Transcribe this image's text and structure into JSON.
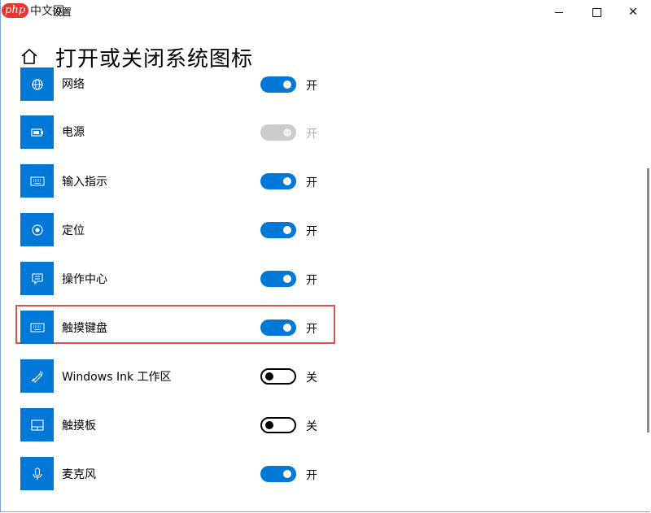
{
  "titlebar": {
    "logo_php": "php",
    "logo_cn": "中文网",
    "app_title": "设置",
    "minimize_icon": "minimize-icon",
    "maximize_icon": "maximize-icon",
    "close_icon": "close-icon",
    "close_glyph": "✕"
  },
  "header": {
    "home_icon": "home-icon",
    "title": "打开或关闭系统图标"
  },
  "items": [
    {
      "label": "网络",
      "state": "开",
      "on": true,
      "disabled": false,
      "icon": "globe-icon"
    },
    {
      "label": "电源",
      "state": "开",
      "on": true,
      "disabled": true,
      "icon": "battery-icon"
    },
    {
      "label": "输入指示",
      "state": "开",
      "on": true,
      "disabled": false,
      "icon": "keyboard-icon"
    },
    {
      "label": "定位",
      "state": "开",
      "on": true,
      "disabled": false,
      "icon": "location-icon"
    },
    {
      "label": "操作中心",
      "state": "开",
      "on": true,
      "disabled": false,
      "icon": "action-center-icon"
    },
    {
      "label": "触摸键盘",
      "state": "开",
      "on": true,
      "disabled": false,
      "icon": "touch-keyboard-icon"
    },
    {
      "label": "Windows Ink 工作区",
      "state": "关",
      "on": false,
      "disabled": false,
      "icon": "pen-icon"
    },
    {
      "label": "触摸板",
      "state": "关",
      "on": false,
      "disabled": false,
      "icon": "touchpad-icon"
    },
    {
      "label": "麦克风",
      "state": "开",
      "on": true,
      "disabled": false,
      "icon": "microphone-icon"
    }
  ],
  "colors": {
    "accent": "#0078d7",
    "highlight": "#d9534f",
    "disabled_track": "#cccccc"
  }
}
